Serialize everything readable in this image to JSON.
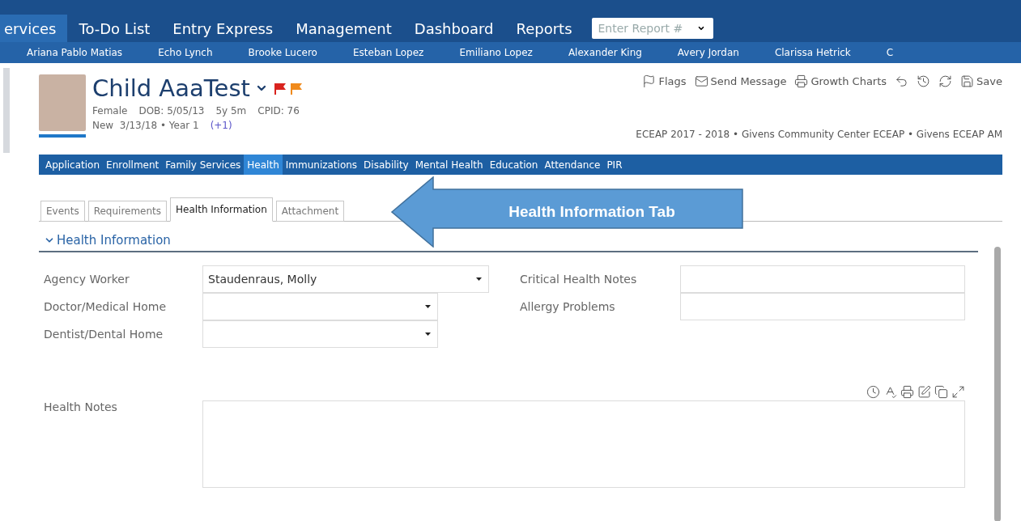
{
  "top_menu": {
    "items": [
      {
        "label": "ervices",
        "selected": true
      },
      {
        "label": "To-Do List",
        "selected": false
      },
      {
        "label": "Entry Express",
        "selected": false
      },
      {
        "label": "Management",
        "selected": false
      },
      {
        "label": "Dashboard",
        "selected": false
      },
      {
        "label": "Reports",
        "selected": false
      }
    ],
    "report_search": {
      "placeholder": "Enter Report #"
    }
  },
  "recent_children": [
    "Ariana Pablo Matias",
    "Echo Lynch",
    "Brooke Lucero",
    "Esteban Lopez",
    "Emiliano Lopez",
    "Alexander King",
    "Avery Jordan",
    "Clarissa Hetrick",
    "C"
  ],
  "child": {
    "name": "Child AaaTest",
    "gender": "Female",
    "dob": "DOB: 5/05/13",
    "age": "5y 5m",
    "cpid": "CPID: 76",
    "status": "New  3/13/18 • Year 1",
    "extra": "(+1)",
    "program": "ECEAP 2017 - 2018 • Givens Community Center ECEAP • Givens ECEAP AM"
  },
  "actions": [
    {
      "kind": "flag",
      "label": "Flags"
    },
    {
      "kind": "mail",
      "label": "Send Message"
    },
    {
      "kind": "print",
      "label": "Growth Charts"
    },
    {
      "kind": "undo"
    },
    {
      "kind": "history"
    },
    {
      "kind": "refresh"
    },
    {
      "kind": "save",
      "label": "Save"
    }
  ],
  "section_nav": [
    {
      "label": "Application",
      "selected": false
    },
    {
      "label": "Enrollment",
      "selected": false
    },
    {
      "label": "Family Services",
      "selected": false
    },
    {
      "label": "Health",
      "selected": true
    },
    {
      "label": "Immunizations",
      "selected": false
    },
    {
      "label": "Disability",
      "selected": false
    },
    {
      "label": "Mental Health",
      "selected": false
    },
    {
      "label": "Education",
      "selected": false
    },
    {
      "label": "Attendance",
      "selected": false
    },
    {
      "label": "PIR",
      "selected": false
    }
  ],
  "tabs": [
    {
      "label": "Events",
      "selected": false
    },
    {
      "label": "Requirements",
      "selected": false
    },
    {
      "label": "Health Information",
      "selected": true
    },
    {
      "label": "Attachment",
      "selected": false
    }
  ],
  "section": {
    "title": "Health Information",
    "expanded": true
  },
  "fields_left": [
    {
      "label": "Agency Worker",
      "value": "Staudenraus, Molly"
    },
    {
      "label": "Doctor/Medical Home"
    },
    {
      "label": "Dentist/Dental Home"
    }
  ],
  "fields_right": [
    {
      "label": "Critical Health Notes"
    },
    {
      "label": "Allergy Problems"
    }
  ],
  "notes": {
    "label": "Health Notes",
    "tools": [
      {
        "kind": "clock"
      },
      {
        "kind": "spellcheck"
      },
      {
        "kind": "print"
      },
      {
        "kind": "edit"
      },
      {
        "kind": "copy"
      },
      {
        "kind": "expand"
      }
    ]
  },
  "callout": {
    "text": "Health Information Tab"
  }
}
